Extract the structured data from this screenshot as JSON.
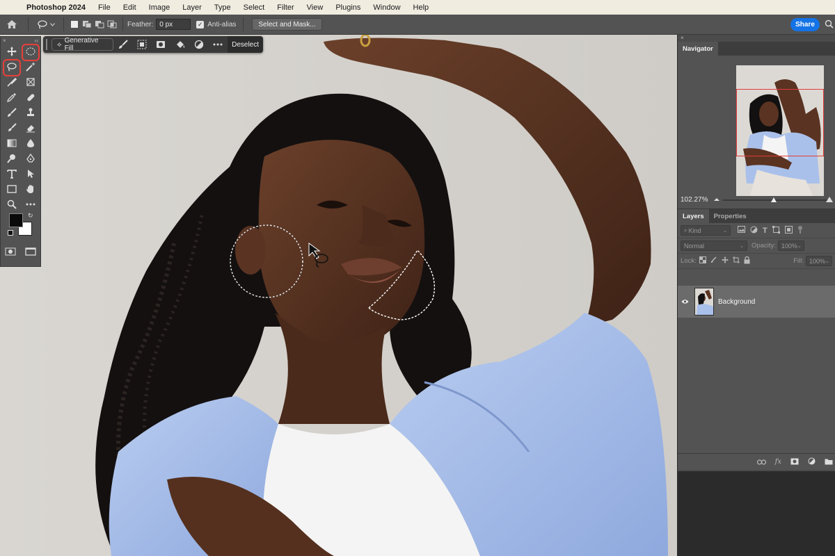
{
  "menubar": {
    "app_name": "Photoshop 2024",
    "items": [
      "File",
      "Edit",
      "Image",
      "Layer",
      "Type",
      "Select",
      "Filter",
      "View",
      "Plugins",
      "Window",
      "Help"
    ]
  },
  "options_bar": {
    "feather_label": "Feather:",
    "feather_value": "0 px",
    "anti_alias_label": "Anti-alias",
    "anti_alias_checked": true,
    "select_mask_label": "Select and Mask...",
    "share_label": "Share"
  },
  "contextual_taskbar": {
    "generative_fill_label": "Generative Fill",
    "deselect_label": "Deselect"
  },
  "tools": {
    "items": [
      "move-tool",
      "elliptical-marquee-tool",
      "lasso-tool",
      "magic-wand-tool",
      "pen-line-tool",
      "frame-tool",
      "eyedropper-tool",
      "healing-brush-tool",
      "brush-tool",
      "clone-stamp-tool",
      "history-brush-tool",
      "eraser-tool",
      "gradient-tool",
      "blur-tool",
      "dodge-tool",
      "pen-tool",
      "type-tool",
      "path-selection-tool",
      "rectangle-tool",
      "hand-tool",
      "zoom-tool",
      "more-tools"
    ],
    "highlighted": [
      "elliptical-marquee-tool",
      "lasso-tool"
    ],
    "foreground_color": "#0a0a0a",
    "background_color": "#ffffff"
  },
  "navigator": {
    "tab_label": "Navigator",
    "zoom": "102.27%"
  },
  "layers_panel": {
    "tabs": [
      "Layers",
      "Properties"
    ],
    "active_tab": "Layers",
    "filter_kind": "Kind",
    "blend_mode": "Normal",
    "opacity_label": "Opacity:",
    "opacity_value": "100%",
    "lock_label": "Lock:",
    "fill_label": "Fill:",
    "fill_value": "100%",
    "layers": [
      {
        "name": "Background",
        "visible": true
      }
    ]
  },
  "colors": {
    "accent": "#1473e6",
    "highlight_ring": "#e8403a",
    "navigator_view_box": "#e43b3b"
  }
}
